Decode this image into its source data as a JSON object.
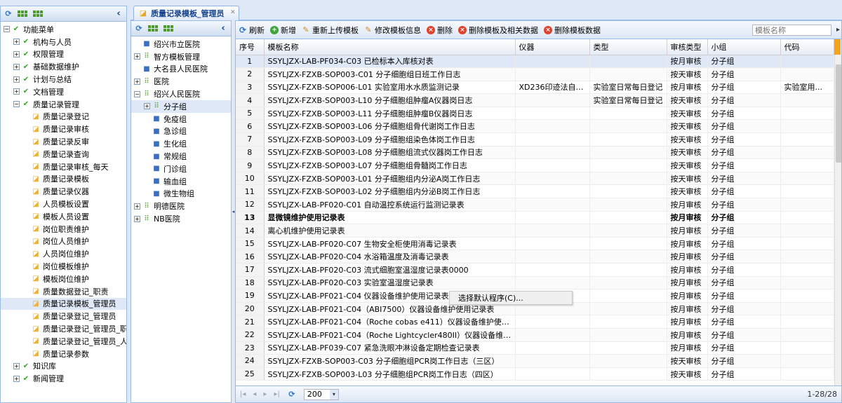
{
  "left_tree": {
    "root": "功能菜单",
    "items": [
      {
        "label": "机构与人员",
        "level": 1,
        "type": "group"
      },
      {
        "label": "权限管理",
        "level": 1,
        "type": "group"
      },
      {
        "label": "基础数据维护",
        "level": 1,
        "type": "group"
      },
      {
        "label": "计划与总结",
        "level": 1,
        "type": "group"
      },
      {
        "label": "文档管理",
        "level": 1,
        "type": "group"
      },
      {
        "label": "质量记录管理",
        "level": 1,
        "type": "group-open"
      },
      {
        "label": "质量记录登记",
        "level": 2,
        "type": "leaf"
      },
      {
        "label": "质量记录审核",
        "level": 2,
        "type": "leaf"
      },
      {
        "label": "质量记录反审",
        "level": 2,
        "type": "leaf"
      },
      {
        "label": "质量记录查询",
        "level": 2,
        "type": "leaf"
      },
      {
        "label": "质量记录审核_每天",
        "level": 2,
        "type": "leaf"
      },
      {
        "label": "质量记录模板",
        "level": 2,
        "type": "leaf"
      },
      {
        "label": "质量记录仪器",
        "level": 2,
        "type": "leaf"
      },
      {
        "label": "人员模板设置",
        "level": 2,
        "type": "leaf"
      },
      {
        "label": "模板人员设置",
        "level": 2,
        "type": "leaf"
      },
      {
        "label": "岗位职责维护",
        "level": 2,
        "type": "leaf"
      },
      {
        "label": "岗位人员维护",
        "level": 2,
        "type": "leaf"
      },
      {
        "label": "人员岗位维护",
        "level": 2,
        "type": "leaf"
      },
      {
        "label": "岗位模板维护",
        "level": 2,
        "type": "leaf"
      },
      {
        "label": "模板岗位维护",
        "level": 2,
        "type": "leaf"
      },
      {
        "label": "质量数据登记_职责",
        "level": 2,
        "type": "leaf"
      },
      {
        "label": "质量记录模板_管理员",
        "level": 2,
        "type": "leaf",
        "selected": true
      },
      {
        "label": "质量记录登记_管理员",
        "level": 2,
        "type": "leaf"
      },
      {
        "label": "质量记录登记_管理员_职",
        "level": 2,
        "type": "leaf"
      },
      {
        "label": "质量记录登记_管理员_人",
        "level": 2,
        "type": "leaf"
      },
      {
        "label": "质量记录参数",
        "level": 2,
        "type": "leaf"
      },
      {
        "label": "知识库",
        "level": 1,
        "type": "group"
      },
      {
        "label": "新闻管理",
        "level": 1,
        "type": "group"
      }
    ]
  },
  "tab": {
    "label": "质量记录模板_管理员"
  },
  "mid_tree": {
    "items": [
      {
        "label": "绍兴市立医院",
        "level": 1,
        "type": "leaf"
      },
      {
        "label": "智方模板管理",
        "level": 1,
        "type": "group"
      },
      {
        "label": "大名县人民医院",
        "level": 1,
        "type": "leaf"
      },
      {
        "label": "医院",
        "level": 1,
        "type": "group"
      },
      {
        "label": "绍兴人民医院",
        "level": 1,
        "type": "group-open"
      },
      {
        "label": "分子组",
        "level": 2,
        "type": "group",
        "selected": true
      },
      {
        "label": "免疫组",
        "level": 3,
        "type": "leaf"
      },
      {
        "label": "急诊组",
        "level": 3,
        "type": "leaf"
      },
      {
        "label": "生化组",
        "level": 3,
        "type": "leaf"
      },
      {
        "label": "常规组",
        "level": 3,
        "type": "leaf"
      },
      {
        "label": "门诊组",
        "level": 3,
        "type": "leaf"
      },
      {
        "label": "输血组",
        "level": 3,
        "type": "leaf"
      },
      {
        "label": "微生物组",
        "level": 3,
        "type": "leaf"
      },
      {
        "label": "明德医院",
        "level": 1,
        "type": "group"
      },
      {
        "label": "NB医院",
        "level": 1,
        "type": "group"
      }
    ]
  },
  "toolbar": {
    "refresh": "刷新",
    "add": "新增",
    "reupload": "重新上传模板",
    "edit": "修改模板信息",
    "delete": "删除",
    "delete_related": "删除模板及相关数据",
    "delete_data": "删除模板数据",
    "search_placeholder": "模板名称"
  },
  "grid": {
    "columns": [
      "序号",
      "模板名称",
      "仪器",
      "类型",
      "审核类型",
      "小组",
      "代码"
    ],
    "rows": [
      [
        "1",
        "SSYLJZX-LAB-PF034-C03 已检标本入库核对表",
        "",
        "",
        "按月审核",
        "分子组",
        ""
      ],
      [
        "2",
        "SSYLJZX-FZXB-SOP003-C01 分子细胞组日班工作日志",
        "",
        "",
        "按天审核",
        "分子组",
        ""
      ],
      [
        "3",
        "SSYLJZX-FZXB-SOP006-L01 实验室用水水质监测记录",
        "XD236印迹法自动...",
        "实验室日常每日登记",
        "按月审核",
        "分子组",
        "实验室用..."
      ],
      [
        "4",
        "SSYLJZX-FZXB-SOP003-L10 分子细胞组肿瘤A仪器岗日志",
        "",
        "实验室日常每日登记",
        "按天审核",
        "分子组",
        ""
      ],
      [
        "5",
        "SSYLJZX-FZXB-SOP003-L11 分子细胞组肿瘤B仪器岗日志",
        "",
        "",
        "按天审核",
        "分子组",
        ""
      ],
      [
        "6",
        "SSYLJZX-FZXB-SOP003-L06 分子细胞组骨代谢岗工作日志",
        "",
        "",
        "按天审核",
        "分子组",
        ""
      ],
      [
        "7",
        "SSYLJZX-FZXB-SOP003-L09 分子细胞组染色体岗工作日志",
        "",
        "",
        "按天审核",
        "分子组",
        ""
      ],
      [
        "8",
        "SSYLJZX-FZXB-SOP003-L08 分子细胞组流式仪器岗工作日志",
        "",
        "",
        "按天审核",
        "分子组",
        ""
      ],
      [
        "9",
        "SSYLJZX-FZXB-SOP003-L07 分子细胞组骨髓岗工作日志",
        "",
        "",
        "按天审核",
        "分子组",
        ""
      ],
      [
        "10",
        "SSYLJZX-FZXB-SOP003-L01 分子细胞组内分泌A岗工作日志",
        "",
        "",
        "按天审核",
        "分子组",
        ""
      ],
      [
        "11",
        "SSYLJZX-FZXB-SOP003-L02 分子细胞组内分泌B岗工作日志",
        "",
        "",
        "按天审核",
        "分子组",
        ""
      ],
      [
        "12",
        "SSYLJZX-LAB-PF020-C01 自动温控系统运行监测记录表",
        "",
        "",
        "按月审核",
        "分子组",
        ""
      ],
      [
        "13",
        "显微镜维护使用记录表",
        "",
        "",
        "按月审核",
        "分子组",
        ""
      ],
      [
        "14",
        "离心机维护使用记录表",
        "",
        "",
        "按月审核",
        "分子组",
        ""
      ],
      [
        "15",
        "SSYLJZX-LAB-PF020-C07 生物安全柜使用消毒记录表",
        "",
        "",
        "按月审核",
        "分子组",
        ""
      ],
      [
        "16",
        "SSYLJZX-LAB-PF020-C04 水浴箱温度及消毒记录表",
        "",
        "",
        "按月审核",
        "分子组",
        ""
      ],
      [
        "17",
        "SSYLJZX-LAB-PF020-C03 流式细胞室温湿度记录表0000",
        "",
        "",
        "按月审核",
        "分子组",
        ""
      ],
      [
        "18",
        "SSYLJZX-LAB-PF020-C03 实验室温湿度记录表",
        "",
        "",
        "按月审核",
        "分子组",
        ""
      ],
      [
        "19",
        "SSYLJZX-LAB-PF021-C04 仪器设备维护使用记录表（",
        "",
        "",
        "按月审核",
        "分子组",
        ""
      ],
      [
        "20",
        "SSYLJZX-LAB-PF021-C04（ABI7500）仪器设备维护使用记录表",
        "",
        "",
        "按月审核",
        "分子组",
        ""
      ],
      [
        "21",
        "SSYLJZX-LAB-PF021-C04（Roche cobas e411）仪器设备维护使用记...",
        "",
        "",
        "按月审核",
        "分子组",
        ""
      ],
      [
        "22",
        "SSYLJZX-LAB-PF021-C04（Roche Lightcycler480II）仪器设备维护使...",
        "",
        "",
        "按月审核",
        "分子组",
        ""
      ],
      [
        "23",
        "SSYLJZX-LAB-PF039-C07 紧急洗眼冲淋设备定期检查记录表",
        "",
        "",
        "按月审核",
        "分子组",
        ""
      ],
      [
        "24",
        "SSYLJZX-FZXB-SOP003-C03 分子细胞组PCR岗工作日志（三区）",
        "",
        "",
        "按天审核",
        "分子组",
        ""
      ],
      [
        "25",
        "SSYLJZX-FZXB-SOP003-L03 分子细胞组PCR岗工作日志（四区）",
        "",
        "",
        "按天审核",
        "分子组",
        ""
      ]
    ]
  },
  "context_menu": {
    "item": "选择默认程序(C)..."
  },
  "pager": {
    "page_size": "200",
    "info": "1-28/28"
  }
}
